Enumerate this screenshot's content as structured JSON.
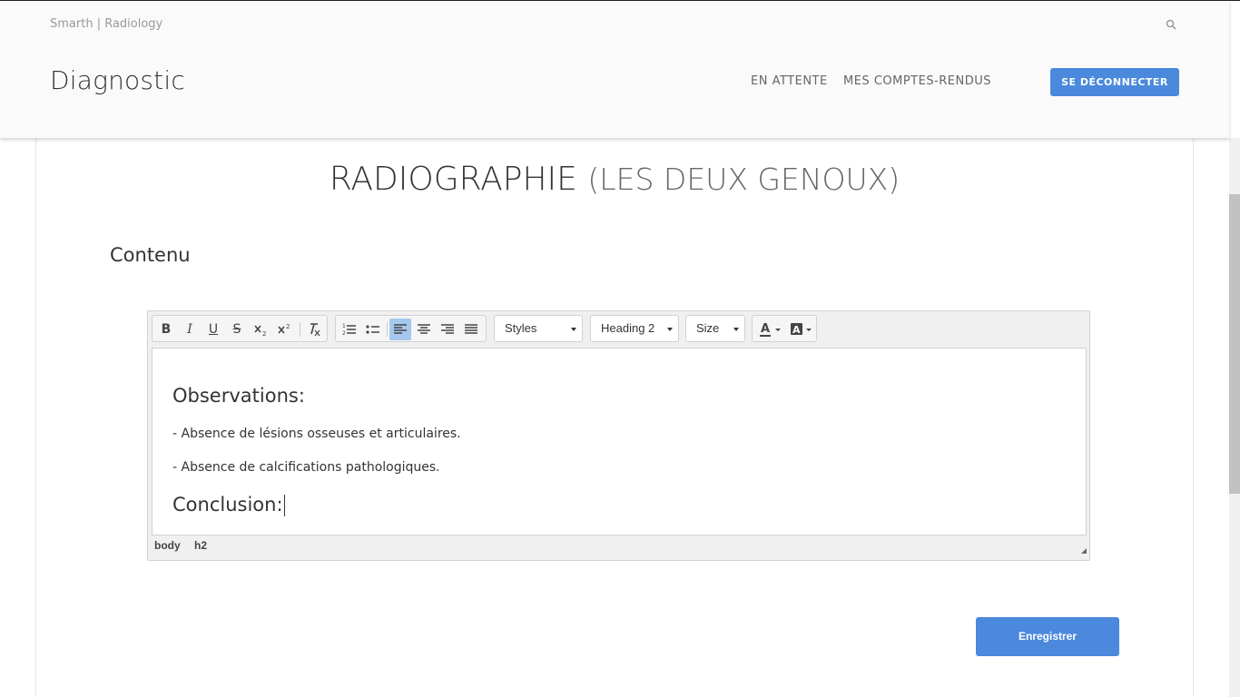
{
  "header": {
    "brand": "Smarth | Radiology",
    "title": "Diagnostic",
    "nav": {
      "waiting": "EN ATTENTE",
      "reports": "MES COMPTES-RENDUS"
    },
    "logout_label": "SE DÉCONNECTER",
    "search_icon": "search-icon"
  },
  "exam": {
    "title": "RADIOGRAPHIE",
    "subtitle": "(LES DEUX GENOUX)"
  },
  "section_label": "Contenu",
  "editor": {
    "toolbar": {
      "bold": "B",
      "italic": "I",
      "underline": "U",
      "strike": "S",
      "styles": "Styles",
      "format": "Heading 2",
      "size": "Size"
    },
    "content": {
      "h2_1": "Observations:",
      "p1": "- Absence de lésions osseuses et articulaires.",
      "p2": "- Absence de calcifications pathologiques.",
      "h2_2": "Conclusion:"
    },
    "path": [
      "body",
      "h2"
    ]
  },
  "save_label": "Enregistrer",
  "colors": {
    "accent": "#4a89dc",
    "active_tool": "#a6c8ed"
  }
}
